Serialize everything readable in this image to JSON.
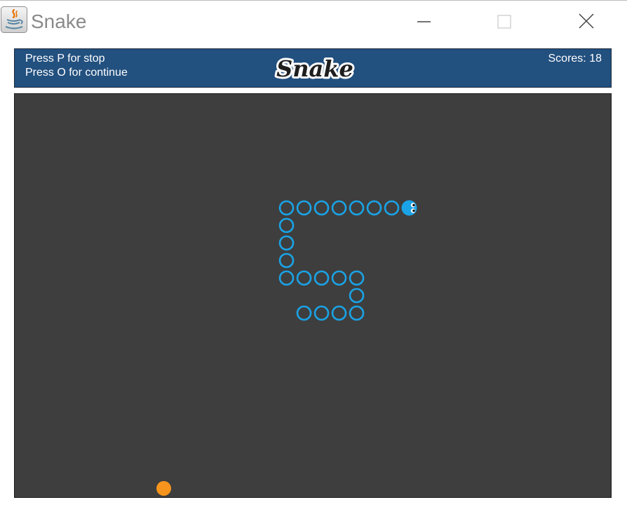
{
  "window": {
    "title": "Snake",
    "controls": [
      "minimize",
      "maximize",
      "close"
    ]
  },
  "header": {
    "help_lines": [
      "Press P for stop",
      "Press O for continue"
    ],
    "logo_text": "Snake",
    "score_label": "Scores:",
    "score": 18
  },
  "board": {
    "columns": 34,
    "rows": 23,
    "snake": {
      "direction": "right",
      "head": [
        22,
        6
      ],
      "body": [
        [
          21,
          6
        ],
        [
          20,
          6
        ],
        [
          19,
          6
        ],
        [
          18,
          6
        ],
        [
          17,
          6
        ],
        [
          16,
          6
        ],
        [
          15,
          6
        ],
        [
          15,
          7
        ],
        [
          15,
          8
        ],
        [
          15,
          9
        ],
        [
          15,
          10
        ],
        [
          16,
          10
        ],
        [
          17,
          10
        ],
        [
          18,
          10
        ],
        [
          19,
          10
        ],
        [
          19,
          11
        ],
        [
          19,
          12
        ],
        [
          18,
          12
        ],
        [
          17,
          12
        ],
        [
          16,
          12
        ]
      ]
    },
    "food": [
      8,
      22
    ]
  },
  "colors": {
    "header_bg": "#22507f",
    "board_bg": "#3e3e3e",
    "snake": "#1aa3e6",
    "food": "#f7941d",
    "text": "#ffffff"
  },
  "icons": {
    "app": "java-coffee-cup-icon",
    "minimize": "minimize-icon",
    "maximize": "maximize-icon",
    "close": "close-icon"
  }
}
